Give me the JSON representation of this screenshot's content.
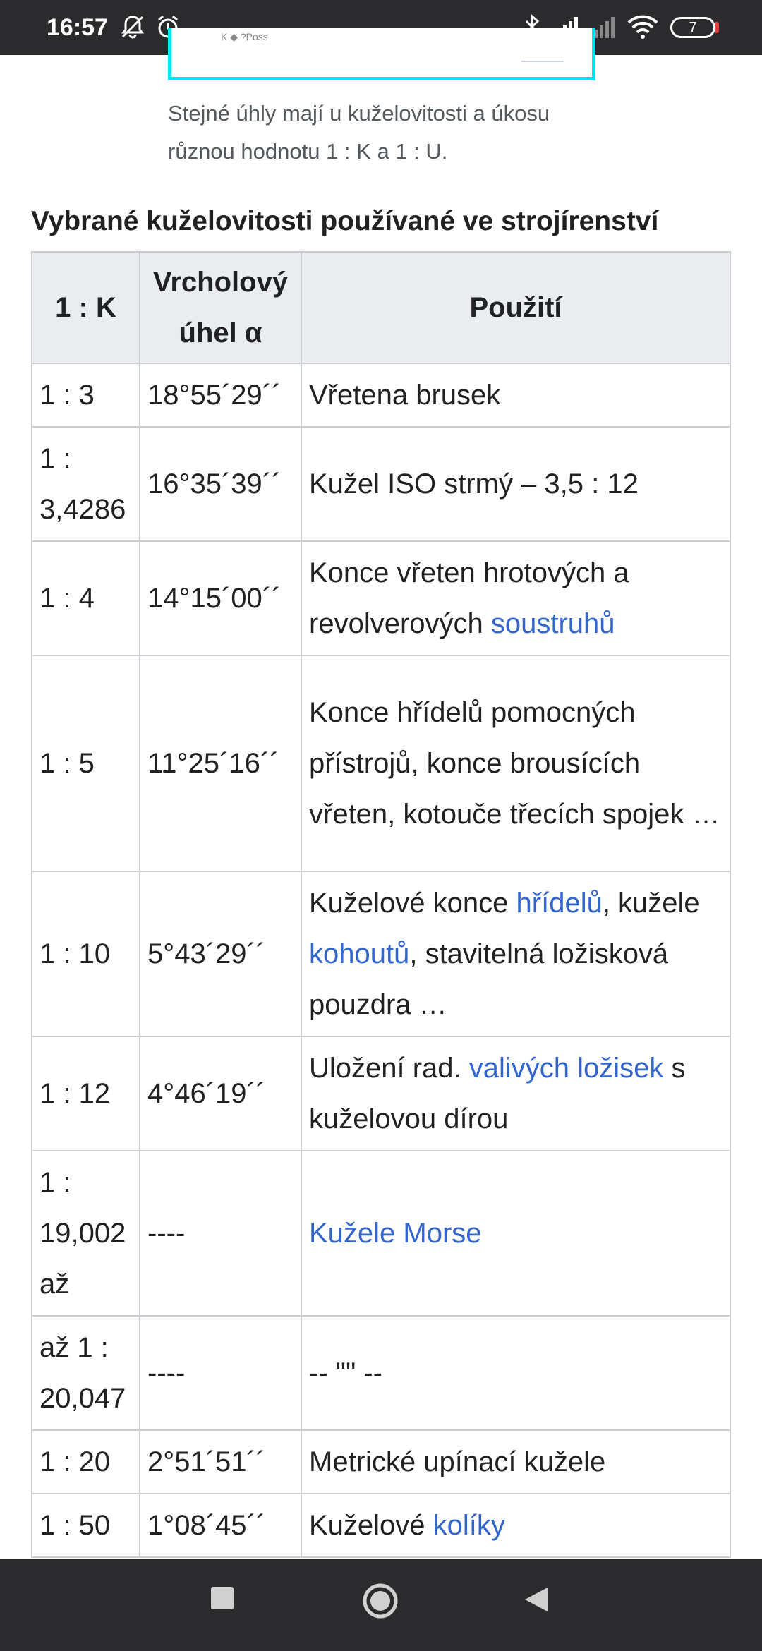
{
  "status_bar": {
    "time": "16:57",
    "icons": [
      "bell-off-icon",
      "alarm-icon",
      "bluetooth-icon",
      "signal-icon",
      "signal-icon",
      "wifi-icon"
    ],
    "battery_level": "7",
    "battery_color": "#e0443a"
  },
  "figure": {
    "caption": "Stejné úhly mají u kuželovitosti a úkosu různou hodnotu 1 : K a 1 : U.",
    "tiny_text": "K ◆ ?Poss"
  },
  "section": {
    "heading": "Vybrané kuželovitosti používané ve strojírenství"
  },
  "table": {
    "headers": [
      "1 : K",
      "Vrcholový úhel α",
      "Použití"
    ],
    "rows": [
      {
        "k": "1 : 3",
        "angle": "18°55´29´´",
        "use": [
          {
            "t": "Vřetena brusek"
          }
        ]
      },
      {
        "k": "1 : 3,4286",
        "angle": "16°35´39´´",
        "use": [
          {
            "t": "Kužel ISO strmý – 3,5 : 12"
          }
        ]
      },
      {
        "k": "1 : 4",
        "angle": "14°15´00´´",
        "use": [
          {
            "t": "Konce vřeten hrotových a revolverových "
          },
          {
            "t": "soustruhů",
            "link": true
          }
        ]
      },
      {
        "k": "1 : 5",
        "angle": "11°25´16´´",
        "use": [
          {
            "t": "Konce hřídelů pomocných přístrojů, konce brousících vřeten, kotouče třecích spojek …"
          }
        ]
      },
      {
        "k": "1 : 10",
        "angle": "5°43´29´´",
        "use": [
          {
            "t": "Kuželové konce "
          },
          {
            "t": "hřídelů",
            "link": true
          },
          {
            "t": ", kužele "
          },
          {
            "t": "kohoutů",
            "link": true
          },
          {
            "t": ", stavitelná ložisková pouzdra …"
          }
        ]
      },
      {
        "k": "1 : 12",
        "angle": "4°46´19´´",
        "use": [
          {
            "t": "Uložení rad. "
          },
          {
            "t": "valivých ložisek",
            "link": true
          },
          {
            "t": " s kuželovou dírou"
          }
        ]
      },
      {
        "k": "1 : 19,002 až",
        "angle": "----",
        "use": [
          {
            "t": "Kužele Morse",
            "link": true
          }
        ]
      },
      {
        "k": "až 1 : 20,047",
        "angle": "----",
        "use": [
          {
            "t": "-- \"\" --"
          }
        ]
      },
      {
        "k": "1 : 20",
        "angle": "2°51´51´´",
        "use": [
          {
            "t": "Metrické upínací kužele"
          }
        ]
      },
      {
        "k": "1 : 50",
        "angle": "1°08´45´´",
        "use": [
          {
            "t": "Kuželové "
          },
          {
            "t": "kolíky",
            "link": true
          }
        ]
      }
    ]
  },
  "nav_bar": {
    "buttons": [
      "recent-apps-button",
      "home-button",
      "back-button"
    ]
  }
}
